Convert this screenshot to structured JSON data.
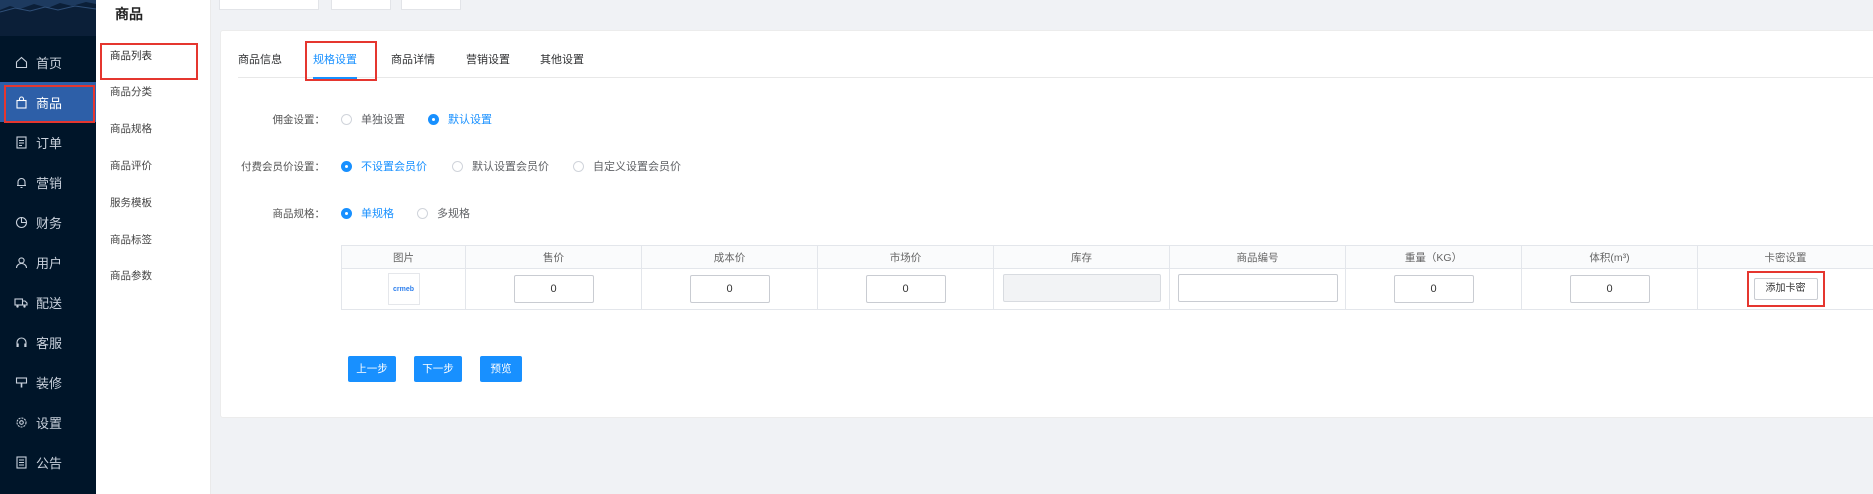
{
  "nav": {
    "items": [
      {
        "label": "首页",
        "icon": "home-icon"
      },
      {
        "label": "商品",
        "icon": "bag-icon",
        "active": true
      },
      {
        "label": "订单",
        "icon": "document-icon"
      },
      {
        "label": "营销",
        "icon": "bell-icon"
      },
      {
        "label": "财务",
        "icon": "pie-icon"
      },
      {
        "label": "用户",
        "icon": "user-icon"
      },
      {
        "label": "配送",
        "icon": "truck-icon"
      },
      {
        "label": "客服",
        "icon": "headset-icon"
      },
      {
        "label": "装修",
        "icon": "brush-icon"
      },
      {
        "label": "设置",
        "icon": "gear-icon"
      },
      {
        "label": "公告",
        "icon": "notice-icon"
      }
    ]
  },
  "submenu": {
    "title": "商品",
    "items": [
      {
        "label": "商品列表",
        "active": true
      },
      {
        "label": "商品分类"
      },
      {
        "label": "商品规格"
      },
      {
        "label": "商品评价"
      },
      {
        "label": "服务模板"
      },
      {
        "label": "商品标签"
      },
      {
        "label": "商品参数"
      }
    ]
  },
  "tabs": [
    {
      "label": "商品信息"
    },
    {
      "label": "规格设置",
      "active": true
    },
    {
      "label": "商品详情"
    },
    {
      "label": "营销设置"
    },
    {
      "label": "其他设置"
    }
  ],
  "form": {
    "commission": {
      "label": "佣金设置：",
      "options": [
        {
          "label": "单独设置",
          "checked": false
        },
        {
          "label": "默认设置",
          "checked": true
        }
      ]
    },
    "member_price": {
      "label": "付费会员价设置：",
      "options": [
        {
          "label": "不设置会员价",
          "checked": true
        },
        {
          "label": "默认设置会员价",
          "checked": false
        },
        {
          "label": "自定义设置会员价",
          "checked": false
        }
      ]
    },
    "spec": {
      "label": "商品规格：",
      "options": [
        {
          "label": "单规格",
          "checked": true
        },
        {
          "label": "多规格",
          "checked": false
        }
      ]
    }
  },
  "table": {
    "headers": [
      "图片",
      "售价",
      "成本价",
      "市场价",
      "库存",
      "商品编号",
      "重量（KG）",
      "体积(m³)",
      "卡密设置"
    ],
    "row": {
      "image_text": "crmeb",
      "price": "0",
      "cost": "0",
      "market": "0",
      "stock": "",
      "code": "",
      "weight": "0",
      "volume": "0",
      "card_button": "添加卡密"
    }
  },
  "buttons": {
    "prev": "上一步",
    "next": "下一步",
    "preview": "预览"
  },
  "colors": {
    "primary": "#1890ff",
    "nav_bg": "#001529",
    "highlight": "#e5362f"
  }
}
